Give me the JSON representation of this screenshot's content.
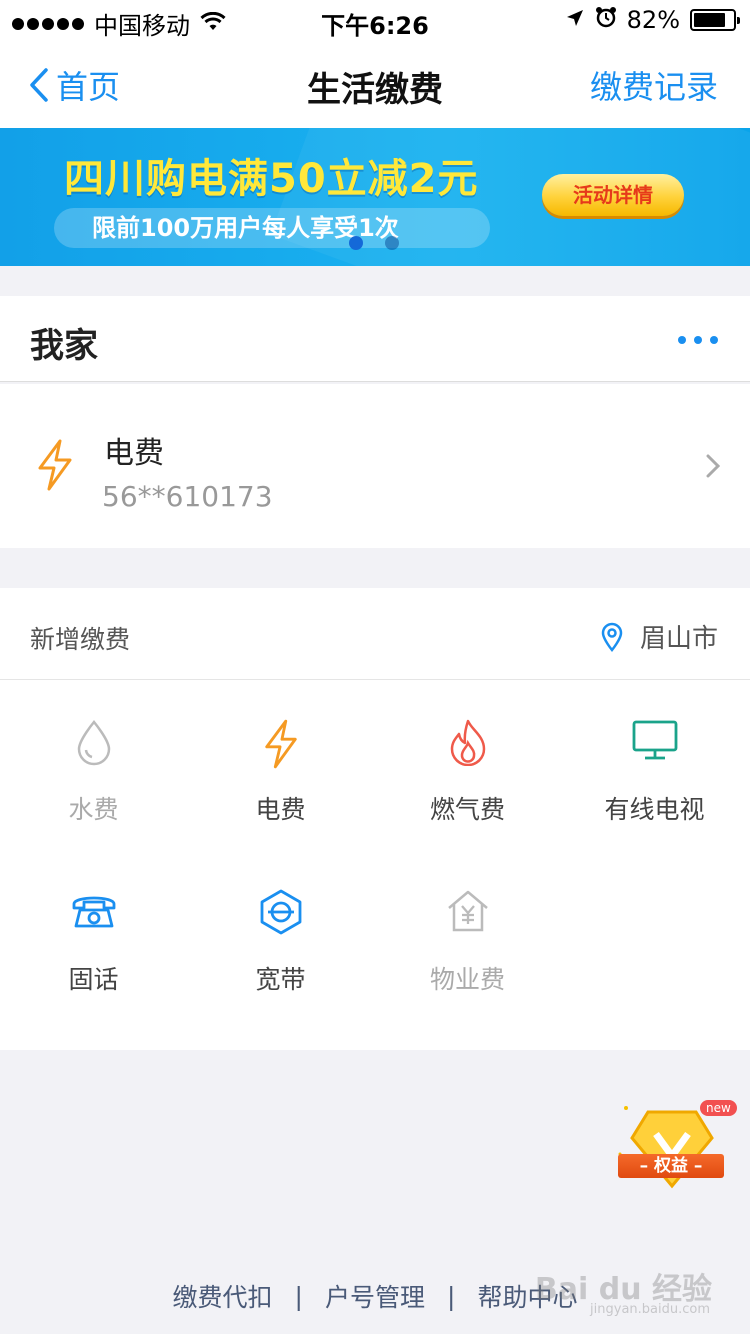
{
  "status_bar": {
    "carrier": "中国移动",
    "time": "下午6:26",
    "battery": "82%",
    "battery_level": 0.82
  },
  "nav": {
    "back_label": "首页",
    "title": "生活缴费",
    "right_label": "缴费记录"
  },
  "banner": {
    "title": "四川购电满50立减2元",
    "subtitle": "限前100万用户每人享受1次",
    "button_label": "活动详情",
    "active_dot": 0,
    "dot_count": 2
  },
  "my_home": {
    "title": "我家",
    "bill": {
      "name": "电费",
      "account": "56**610173",
      "icon": "lightning-icon"
    }
  },
  "add_payment": {
    "title": "新增缴费",
    "city": "眉山市",
    "items": [
      {
        "label": "水费",
        "icon": "water-drop-icon",
        "enabled": false,
        "color": "#bbbbbb"
      },
      {
        "label": "电费",
        "icon": "lightning-icon",
        "enabled": true,
        "color": "#f59a23"
      },
      {
        "label": "燃气费",
        "icon": "flame-icon",
        "enabled": true,
        "color": "#ef5a4a"
      },
      {
        "label": "有线电视",
        "icon": "tv-icon",
        "enabled": true,
        "color": "#1aa38a"
      },
      {
        "label": "固话",
        "icon": "telephone-icon",
        "enabled": true,
        "color": "#1a8ff0"
      },
      {
        "label": "宽带",
        "icon": "broadband-icon",
        "enabled": true,
        "color": "#1a8ff0"
      },
      {
        "label": "物业费",
        "icon": "property-icon",
        "enabled": false,
        "color": "#bbbbbb"
      }
    ]
  },
  "floating_badge": {
    "new_label": "new",
    "ribbon_label": "权益"
  },
  "footer": {
    "links": [
      "缴费代扣",
      "户号管理",
      "帮助中心"
    ],
    "separator": "|"
  },
  "watermark": {
    "text": "Bai du 经验",
    "sub": "jingyan.baidu.com"
  },
  "colors": {
    "accent": "#1a8ff0",
    "banner_bg": "#12a0e8"
  }
}
